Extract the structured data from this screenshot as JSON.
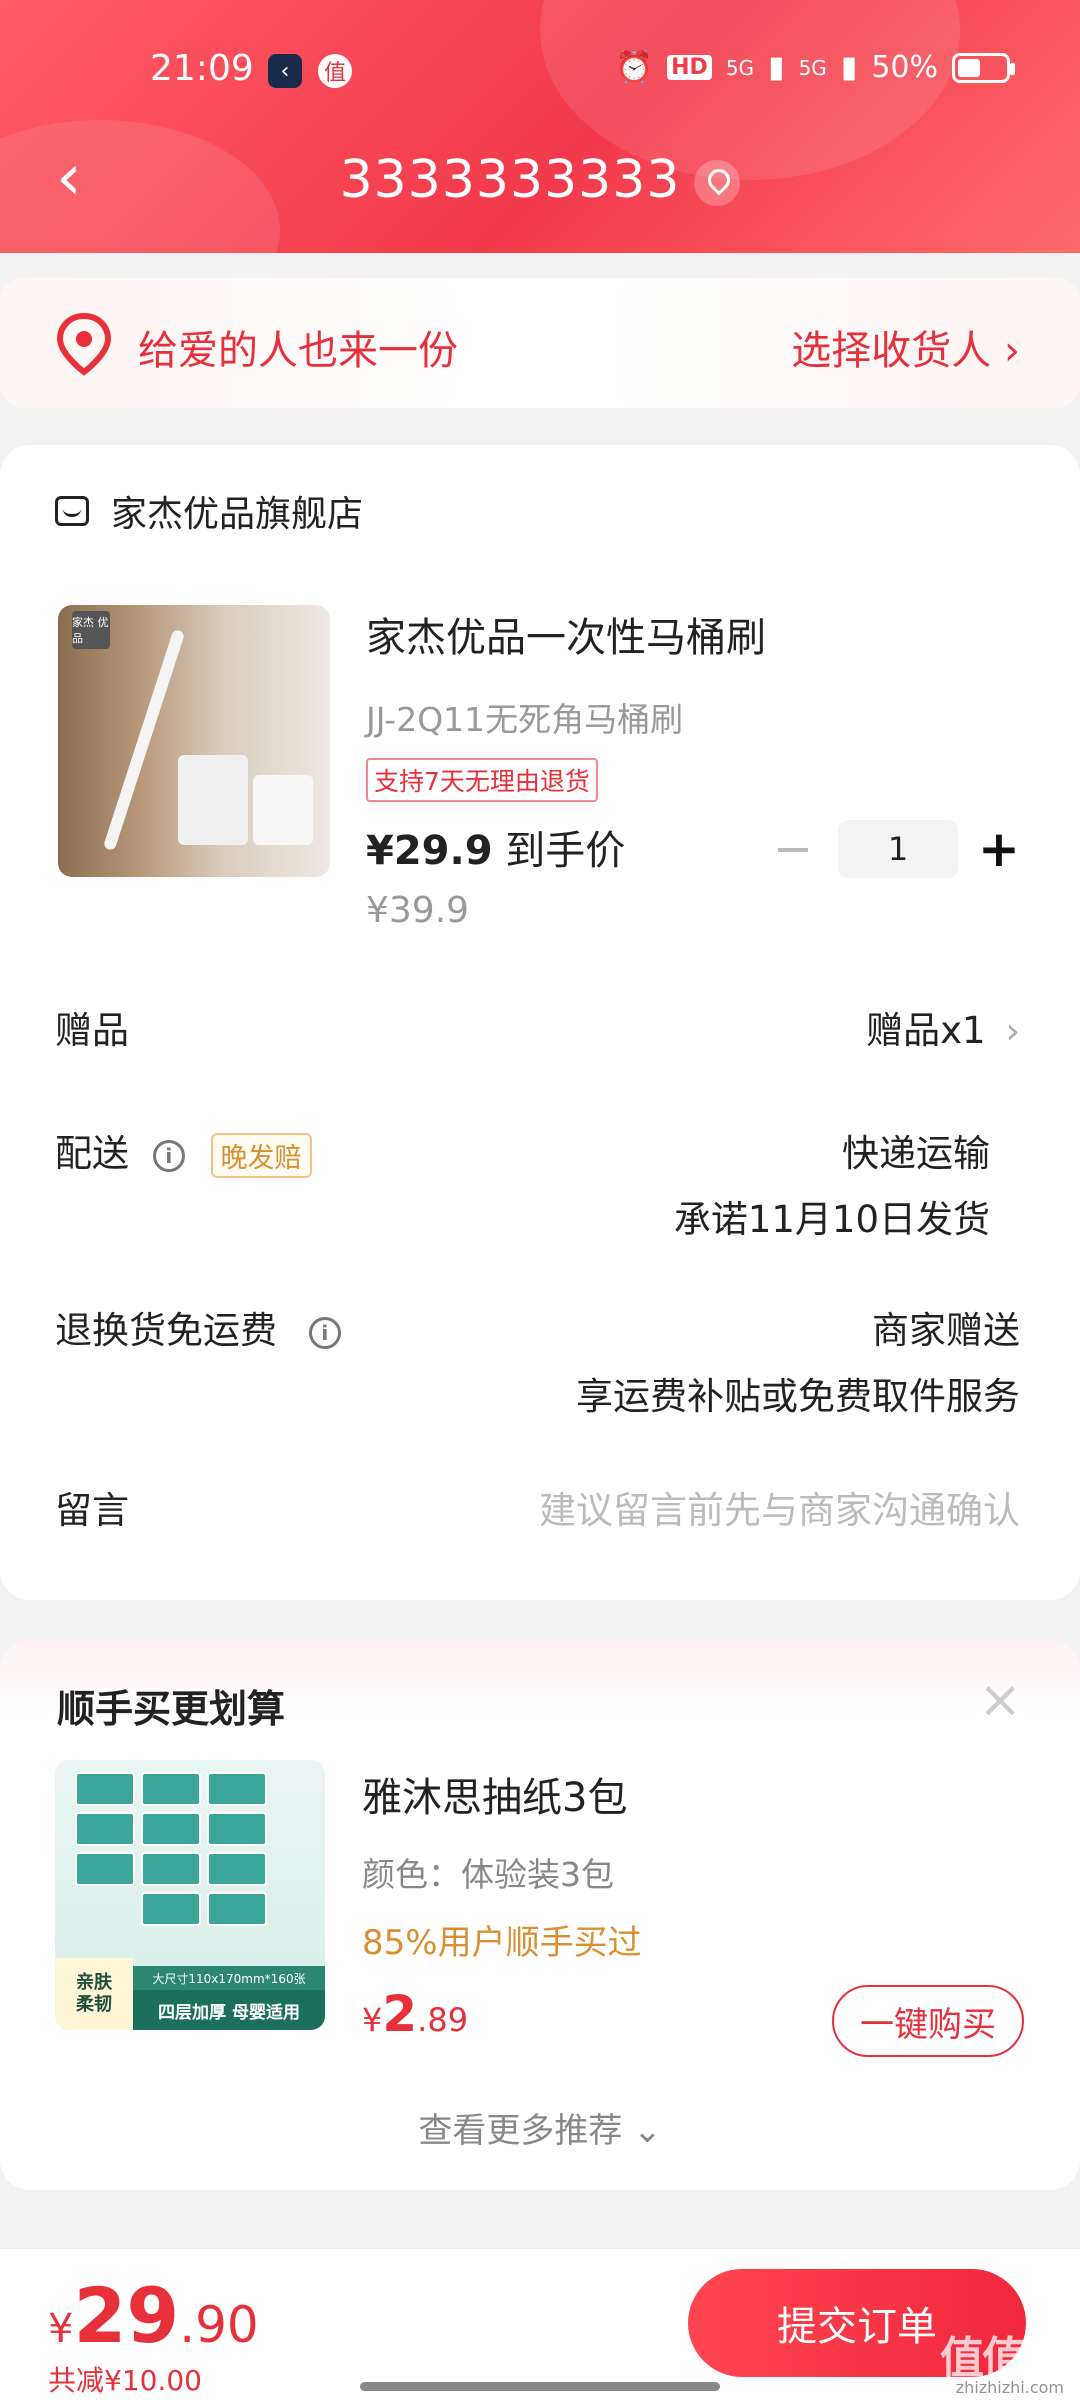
{
  "status_bar": {
    "time": "21:09",
    "app_icon_1": "‹",
    "app_icon_2": "值",
    "alarm_icon": "alarm-icon",
    "hd": "HD",
    "signal1": "5G",
    "signal2": "5G",
    "battery": "50%"
  },
  "nav": {
    "back": "‹",
    "title": "3333333333"
  },
  "gift_banner": {
    "text": "给爱的人也来一份",
    "link": "选择收货人 ›"
  },
  "order": {
    "shop_name": "家杰优品旗舰店",
    "product": {
      "image_logo": "家杰\n优品",
      "title": "家杰优品一次性马桶刷",
      "spec": "JJ-2Q11无死角马桶刷",
      "badge": "支持7天无理由退货",
      "price": "¥29.9",
      "price_suffix": " 到手价",
      "original_price": "¥39.9",
      "quantity": "1",
      "minus": "−",
      "plus": "+"
    },
    "rows": {
      "gift_label": "赠品",
      "gift_value": "赠品x1",
      "delivery_label": "配送",
      "delivery_badge": "晚发赔",
      "delivery_value_1": "快递运输",
      "delivery_value_2": "承诺11月10日发货",
      "return_label": "退换货免运费",
      "return_value_1": "商家赠送",
      "return_value_2": "享运费补贴或免费取件服务",
      "note_label": "留言",
      "note_placeholder": "建议留言前先与商家沟通确认"
    }
  },
  "recommend": {
    "title": "顺手买更划算",
    "close": "×",
    "item": {
      "tag1": "亲肤\n柔韧",
      "tag2": "四层加厚 母婴适用",
      "tag3": "大尺寸110x170mm*160张",
      "name": "雅沐思抽纸3包",
      "spec": "颜色：体验装3包",
      "social": "85%用户顺手买过",
      "price_cur": "¥",
      "price_int": "2",
      "price_dec": ".89",
      "buy_label": "一键购买"
    },
    "more": "查看更多推荐 ⌄"
  },
  "bottom": {
    "total_cur": "¥",
    "total_int": "29",
    "total_dec": ".90",
    "saved": "共减¥10.00",
    "submit": "提交订单"
  },
  "watermark": {
    "main": "值值值",
    "sub": "zhizhizhi.com"
  },
  "colors": {
    "brand_red": "#e8303b",
    "orange": "#d99031"
  }
}
